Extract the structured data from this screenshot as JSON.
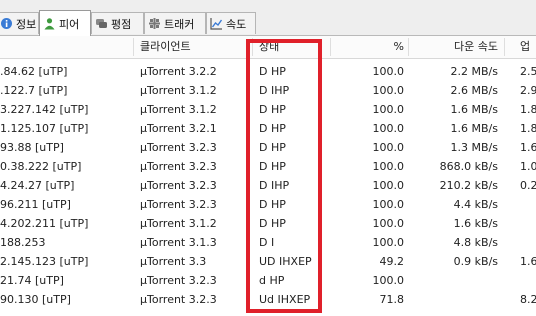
{
  "tabs": [
    {
      "label": "정보",
      "icon": "info-icon"
    },
    {
      "label": "피어",
      "icon": "peers-icon"
    },
    {
      "label": "평점",
      "icon": "ratings-icon"
    },
    {
      "label": "트래커",
      "icon": "trackers-icon"
    },
    {
      "label": "속도",
      "icon": "speed-graph-icon"
    }
  ],
  "columns": {
    "ip": "",
    "client": "클라이언트",
    "flags": "상태",
    "percent": "%",
    "down": "다운 속도",
    "up": "업"
  },
  "peers": [
    {
      "ip": ".84.62 [uTP]",
      "client": "µTorrent 3.2.2",
      "flags": "D HP",
      "percent": "100.0",
      "down": "2.2 MB/s",
      "up": "2.5"
    },
    {
      "ip": ".122.7 [uTP]",
      "client": "µTorrent 3.1.2",
      "flags": "D IHP",
      "percent": "100.0",
      "down": "2.6 MB/s",
      "up": "2.9"
    },
    {
      "ip": "3.227.142 [uTP]",
      "client": "µTorrent 3.1.2",
      "flags": "D HP",
      "percent": "100.0",
      "down": "1.6 MB/s",
      "up": "1.8"
    },
    {
      "ip": "1.125.107 [uTP]",
      "client": "µTorrent 3.2.1",
      "flags": "D HP",
      "percent": "100.0",
      "down": "1.6 MB/s",
      "up": "1.8"
    },
    {
      "ip": "93.88 [uTP]",
      "client": "µTorrent 3.2.3",
      "flags": "D HP",
      "percent": "100.0",
      "down": "1.3 MB/s",
      "up": "1.6"
    },
    {
      "ip": "0.38.222 [uTP]",
      "client": "µTorrent 3.2.3",
      "flags": "D HP",
      "percent": "100.0",
      "down": "868.0 kB/s",
      "up": "1.0"
    },
    {
      "ip": "4.24.27 [uTP]",
      "client": "µTorrent 3.2.3",
      "flags": "D IHP",
      "percent": "100.0",
      "down": "210.2 kB/s",
      "up": "0.2"
    },
    {
      "ip": "96.211 [uTP]",
      "client": "µTorrent 3.2.3",
      "flags": "D HP",
      "percent": "100.0",
      "down": "4.4 kB/s",
      "up": ""
    },
    {
      "ip": "4.202.211 [uTP]",
      "client": "µTorrent 3.1.2",
      "flags": "D HP",
      "percent": "100.0",
      "down": "1.6 kB/s",
      "up": ""
    },
    {
      "ip": "188.253",
      "client": "µTorrent 3.1.3",
      "flags": "D I",
      "percent": "100.0",
      "down": "4.8 kB/s",
      "up": ""
    },
    {
      "ip": "2.145.123 [uTP]",
      "client": "µTorrent 3.3",
      "flags": "UD IHXEP",
      "percent": "49.2",
      "down": "0.9 kB/s",
      "up": "1.6"
    },
    {
      "ip": "21.74 [uTP]",
      "client": "µTorrent 3.2.3",
      "flags": "d HP",
      "percent": "100.0",
      "down": "",
      "up": ""
    },
    {
      "ip": "90.130 [uTP]",
      "client": "µTorrent 3.2.3",
      "flags": "Ud IHXEP",
      "percent": "71.8",
      "down": "",
      "up": "8.2"
    }
  ],
  "highlight_color": "#e0202a"
}
